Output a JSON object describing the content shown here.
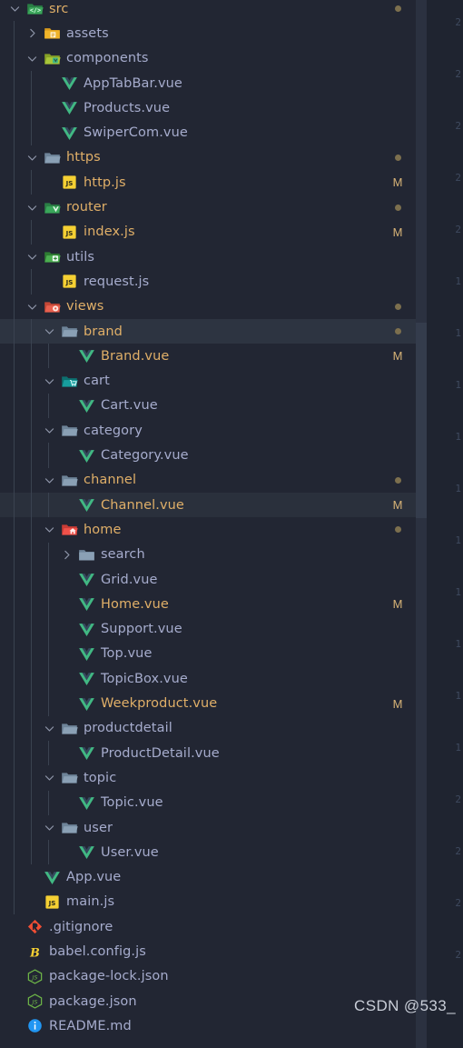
{
  "window": {
    "app": "Visual Studio Code",
    "panel": "explorer-file-tree",
    "watermark": "CSDN @533_"
  },
  "colors": {
    "sidebar_bg": "#222633",
    "editor_bg": "#1f2430",
    "selected_row": "#2d3441",
    "file_text": "#a6accd",
    "modified_text": "#e0af68",
    "vue_green": "#41b883",
    "js_yellow": "#f5d033",
    "folder_grey": "#8aa0b5",
    "folder_green": "#3aa65a",
    "folder_red": "#e8604f",
    "folder_teal": "#179e9e",
    "folder_home": "#f0514a",
    "folder_yellow": "#f0b429",
    "node_green": "#6cb247",
    "git_orange": "#f04e34",
    "babel_yellow": "#f5d033",
    "readme_blue": "#2196f3",
    "gutter_marker": "#d7b377",
    "indent_guide": "#3a4250"
  },
  "tree": [
    {
      "label": "src",
      "depth": 0,
      "type": "folder",
      "icon": "folder-src",
      "state": "expanded",
      "name_color": "modified",
      "marker": "dot",
      "selected": false
    },
    {
      "label": "assets",
      "depth": 1,
      "type": "folder",
      "icon": "folder-assets",
      "state": "collapsed",
      "name_color": "normal",
      "marker": "",
      "selected": false
    },
    {
      "label": "components",
      "depth": 1,
      "type": "folder",
      "icon": "folder-components",
      "state": "expanded",
      "name_color": "normal",
      "marker": "",
      "selected": false
    },
    {
      "label": "AppTabBar.vue",
      "depth": 2,
      "type": "file",
      "icon": "vue",
      "state": "",
      "name_color": "normal",
      "marker": "",
      "selected": false
    },
    {
      "label": "Products.vue",
      "depth": 2,
      "type": "file",
      "icon": "vue",
      "state": "",
      "name_color": "normal",
      "marker": "",
      "selected": false
    },
    {
      "label": "SwiperCom.vue",
      "depth": 2,
      "type": "file",
      "icon": "vue",
      "state": "",
      "name_color": "normal",
      "marker": "",
      "selected": false
    },
    {
      "label": "https",
      "depth": 1,
      "type": "folder",
      "icon": "folder-plain",
      "state": "expanded",
      "name_color": "modified",
      "marker": "dot",
      "selected": false
    },
    {
      "label": "http.js",
      "depth": 2,
      "type": "file",
      "icon": "js",
      "state": "",
      "name_color": "modified",
      "marker": "M",
      "selected": false
    },
    {
      "label": "router",
      "depth": 1,
      "type": "folder",
      "icon": "folder-router",
      "state": "expanded",
      "name_color": "modified",
      "marker": "dot",
      "selected": false
    },
    {
      "label": "index.js",
      "depth": 2,
      "type": "file",
      "icon": "js",
      "state": "",
      "name_color": "modified",
      "marker": "M",
      "selected": false
    },
    {
      "label": "utils",
      "depth": 1,
      "type": "folder",
      "icon": "folder-utils",
      "state": "expanded",
      "name_color": "normal",
      "marker": "",
      "selected": false
    },
    {
      "label": "request.js",
      "depth": 2,
      "type": "file",
      "icon": "js",
      "state": "",
      "name_color": "normal",
      "marker": "",
      "selected": false
    },
    {
      "label": "views",
      "depth": 1,
      "type": "folder",
      "icon": "folder-views",
      "state": "expanded",
      "name_color": "modified",
      "marker": "dot",
      "selected": false
    },
    {
      "label": "brand",
      "depth": 2,
      "type": "folder",
      "icon": "folder-plain",
      "state": "expanded",
      "name_color": "modified",
      "marker": "dot",
      "selected": true
    },
    {
      "label": "Brand.vue",
      "depth": 3,
      "type": "file",
      "icon": "vue",
      "state": "",
      "name_color": "modified",
      "marker": "M",
      "selected": false
    },
    {
      "label": "cart",
      "depth": 2,
      "type": "folder",
      "icon": "folder-cart",
      "state": "expanded",
      "name_color": "normal",
      "marker": "",
      "selected": false
    },
    {
      "label": "Cart.vue",
      "depth": 3,
      "type": "file",
      "icon": "vue",
      "state": "",
      "name_color": "normal",
      "marker": "",
      "selected": false
    },
    {
      "label": "category",
      "depth": 2,
      "type": "folder",
      "icon": "folder-plain",
      "state": "expanded",
      "name_color": "normal",
      "marker": "",
      "selected": false
    },
    {
      "label": "Category.vue",
      "depth": 3,
      "type": "file",
      "icon": "vue",
      "state": "",
      "name_color": "normal",
      "marker": "",
      "selected": false
    },
    {
      "label": "channel",
      "depth": 2,
      "type": "folder",
      "icon": "folder-plain",
      "state": "expanded",
      "name_color": "modified",
      "marker": "dot",
      "selected": false
    },
    {
      "label": "Channel.vue",
      "depth": 3,
      "type": "file",
      "icon": "vue",
      "state": "",
      "name_color": "modified",
      "marker": "M",
      "selected": true
    },
    {
      "label": "home",
      "depth": 2,
      "type": "folder",
      "icon": "folder-home",
      "state": "expanded",
      "name_color": "modified",
      "marker": "dot",
      "selected": false
    },
    {
      "label": "search",
      "depth": 3,
      "type": "folder",
      "icon": "folder-plain",
      "state": "collapsed",
      "name_color": "normal",
      "marker": "",
      "selected": false
    },
    {
      "label": "Grid.vue",
      "depth": 3,
      "type": "file",
      "icon": "vue",
      "state": "",
      "name_color": "normal",
      "marker": "",
      "selected": false
    },
    {
      "label": "Home.vue",
      "depth": 3,
      "type": "file",
      "icon": "vue",
      "state": "",
      "name_color": "modified",
      "marker": "M",
      "selected": false
    },
    {
      "label": "Support.vue",
      "depth": 3,
      "type": "file",
      "icon": "vue",
      "state": "",
      "name_color": "normal",
      "marker": "",
      "selected": false
    },
    {
      "label": "Top.vue",
      "depth": 3,
      "type": "file",
      "icon": "vue",
      "state": "",
      "name_color": "normal",
      "marker": "",
      "selected": false
    },
    {
      "label": "TopicBox.vue",
      "depth": 3,
      "type": "file",
      "icon": "vue",
      "state": "",
      "name_color": "normal",
      "marker": "",
      "selected": false
    },
    {
      "label": "Weekproduct.vue",
      "depth": 3,
      "type": "file",
      "icon": "vue",
      "state": "",
      "name_color": "modified",
      "marker": "M",
      "selected": false
    },
    {
      "label": "productdetail",
      "depth": 2,
      "type": "folder",
      "icon": "folder-plain",
      "state": "expanded",
      "name_color": "normal",
      "marker": "",
      "selected": false
    },
    {
      "label": "ProductDetail.vue",
      "depth": 3,
      "type": "file",
      "icon": "vue",
      "state": "",
      "name_color": "normal",
      "marker": "",
      "selected": false
    },
    {
      "label": "topic",
      "depth": 2,
      "type": "folder",
      "icon": "folder-plain",
      "state": "expanded",
      "name_color": "normal",
      "marker": "",
      "selected": false
    },
    {
      "label": "Topic.vue",
      "depth": 3,
      "type": "file",
      "icon": "vue",
      "state": "",
      "name_color": "normal",
      "marker": "",
      "selected": false
    },
    {
      "label": "user",
      "depth": 2,
      "type": "folder",
      "icon": "folder-plain",
      "state": "expanded",
      "name_color": "normal",
      "marker": "",
      "selected": false
    },
    {
      "label": "User.vue",
      "depth": 3,
      "type": "file",
      "icon": "vue",
      "state": "",
      "name_color": "normal",
      "marker": "",
      "selected": false
    },
    {
      "label": "App.vue",
      "depth": 1,
      "type": "file",
      "icon": "vue",
      "state": "",
      "name_color": "normal",
      "marker": "",
      "selected": false
    },
    {
      "label": "main.js",
      "depth": 1,
      "type": "file",
      "icon": "js",
      "state": "",
      "name_color": "normal",
      "marker": "",
      "selected": false
    },
    {
      "label": ".gitignore",
      "depth": 0,
      "type": "file",
      "icon": "git",
      "state": "",
      "name_color": "normal",
      "marker": "",
      "selected": false
    },
    {
      "label": "babel.config.js",
      "depth": 0,
      "type": "file",
      "icon": "babel",
      "state": "",
      "name_color": "normal",
      "marker": "",
      "selected": false
    },
    {
      "label": "package-lock.json",
      "depth": 0,
      "type": "file",
      "icon": "node",
      "state": "",
      "name_color": "normal",
      "marker": "",
      "selected": false
    },
    {
      "label": "package.json",
      "depth": 0,
      "type": "file",
      "icon": "node",
      "state": "",
      "name_color": "normal",
      "marker": "",
      "selected": false
    },
    {
      "label": "README.md",
      "depth": 0,
      "type": "file",
      "icon": "info",
      "state": "",
      "name_color": "normal",
      "marker": "",
      "selected": false
    }
  ],
  "editor": {
    "line_numbers": [
      "2",
      "2",
      "2",
      "2",
      "2",
      "1",
      "1",
      "1",
      "1",
      "1",
      "1",
      "1",
      "1",
      "1",
      "1",
      "2",
      "2",
      "2",
      "2"
    ]
  }
}
